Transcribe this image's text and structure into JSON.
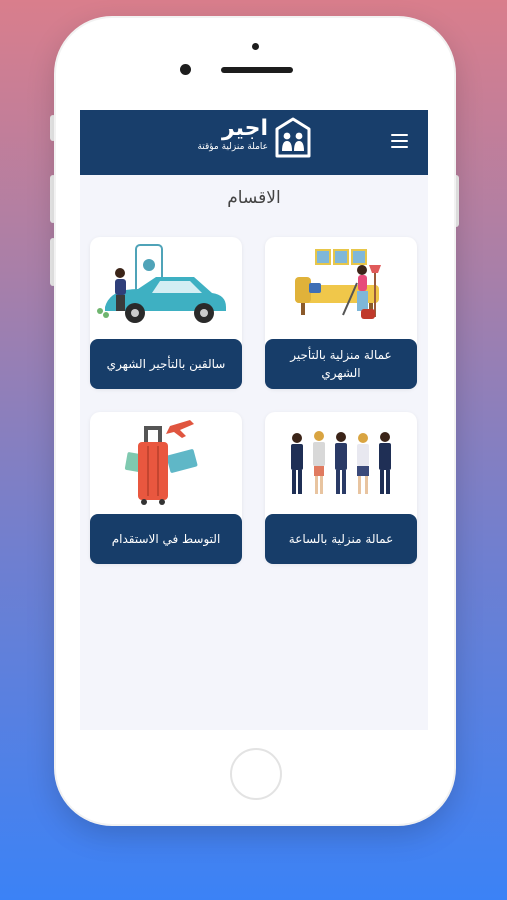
{
  "header": {
    "app_name": "اجير",
    "tagline": "عاملة منزلية مؤقتة",
    "menu_icon": "hamburger-menu-icon",
    "logo_icon": "house-people-logo-icon"
  },
  "main": {
    "section_title": "الاقسام",
    "categories": [
      {
        "label": "عمالة منزلية بالتأجير الشهري",
        "icon": "housekeeper-vacuum-illustration"
      },
      {
        "label": "سالقين بالتأجير الشهري",
        "icon": "driver-car-illustration"
      },
      {
        "label": "عمالة منزلية بالساعة",
        "icon": "workers-group-illustration"
      },
      {
        "label": "التوسط في الاستقدام",
        "icon": "suitcase-travel-illustration"
      }
    ]
  },
  "colors": {
    "header_bg": "#183e6b",
    "card_label_bg": "#173d69",
    "screen_bg": "#f4f5fb"
  }
}
